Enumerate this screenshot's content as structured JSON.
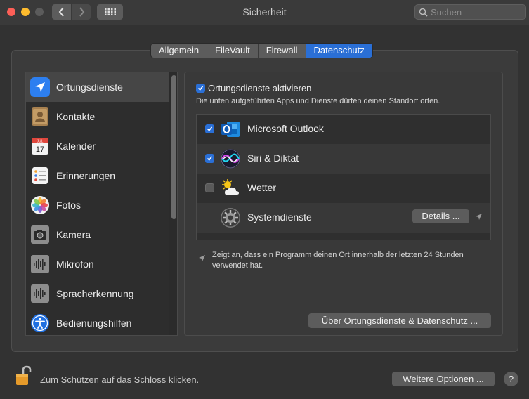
{
  "window": {
    "title": "Sicherheit"
  },
  "search": {
    "placeholder": "Suchen"
  },
  "tabs": [
    {
      "label": "Allgemein",
      "active": false
    },
    {
      "label": "FileVault",
      "active": false
    },
    {
      "label": "Firewall",
      "active": false
    },
    {
      "label": "Datenschutz",
      "active": true
    }
  ],
  "sidebar": {
    "items": [
      {
        "label": "Ortungsdienste",
        "icon": "location-arrow-icon",
        "selected": true
      },
      {
        "label": "Kontakte",
        "icon": "contacts-icon",
        "selected": false
      },
      {
        "label": "Kalender",
        "icon": "calendar-icon",
        "selected": false,
        "icon_month": "JUL",
        "icon_day": "17"
      },
      {
        "label": "Erinnerungen",
        "icon": "reminders-icon",
        "selected": false
      },
      {
        "label": "Fotos",
        "icon": "photos-icon",
        "selected": false
      },
      {
        "label": "Kamera",
        "icon": "camera-icon",
        "selected": false
      },
      {
        "label": "Mikrofon",
        "icon": "microphone-icon",
        "selected": false
      },
      {
        "label": "Spracherkennung",
        "icon": "speech-recognition-icon",
        "selected": false
      },
      {
        "label": "Bedienungshilfen",
        "icon": "accessibility-icon",
        "selected": false
      }
    ]
  },
  "content": {
    "enable_label": "Ortungsdienste aktivieren",
    "enable_checked": true,
    "description": "Die unten aufgeführten Apps und Dienste dürfen deinen Standort orten.",
    "apps": [
      {
        "label": "Microsoft Outlook",
        "checked": true,
        "icon": "outlook-icon"
      },
      {
        "label": "Siri & Diktat",
        "checked": true,
        "icon": "siri-icon"
      },
      {
        "label": "Wetter",
        "checked": false,
        "icon": "weather-icon"
      },
      {
        "label": "Systemdienste",
        "icon": "system-services-gear-icon",
        "details_label": "Details ..."
      }
    ],
    "note": "Zeigt an, dass ein Programm deinen Ort innerhalb der letzten 24 Stunden verwendet hat.",
    "about_button": "Über Ortungsdienste & Datenschutz ..."
  },
  "footer": {
    "lock_text": "Zum Schützen auf das Schloss klicken.",
    "more_options": "Weitere Optionen ...",
    "help": "?"
  },
  "colors": {
    "accent": "#2a6fd6",
    "close": "#fd5f57",
    "minimize": "#febc2e"
  }
}
